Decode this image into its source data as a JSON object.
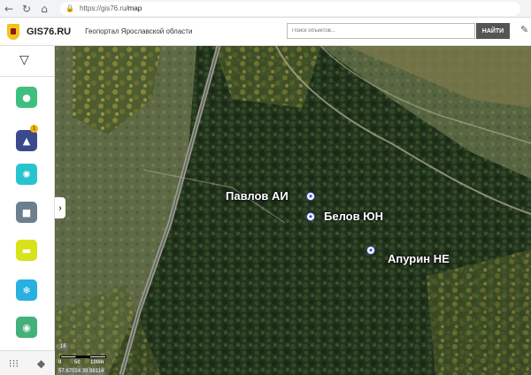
{
  "browser": {
    "url_host": "https://gis76.ru",
    "url_path": "/map"
  },
  "header": {
    "brand": "GIS76.RU",
    "subtitle": "Геопортал Ярославской области",
    "search_placeholder": "Поиск объектов...",
    "search_button": "НАЙТИ"
  },
  "sidebar": {
    "tools": [
      {
        "icon": "globe-icon",
        "color": "#3fbf7f"
      },
      {
        "icon": "monument-icon",
        "color": "#3a4a8c",
        "badge": "1"
      },
      {
        "icon": "sun-icon",
        "color": "#27c4d0"
      },
      {
        "icon": "camera-icon",
        "color": "#6d7f8f"
      },
      {
        "icon": "chat-icon",
        "color": "#d8e21a"
      },
      {
        "icon": "snowflake-icon",
        "color": "#27b0e0"
      },
      {
        "icon": "location-pin-icon",
        "color": "#44b07a"
      }
    ]
  },
  "map": {
    "labels": [
      {
        "text": "Павлов АИ"
      },
      {
        "text": "Белов ЮН"
      },
      {
        "text": "Апурин НЕ"
      }
    ],
    "zoom_text": "16",
    "scale": {
      "t0": "0",
      "t1": "50",
      "t2": "100m"
    },
    "coords": "57.67024  39.98114"
  }
}
